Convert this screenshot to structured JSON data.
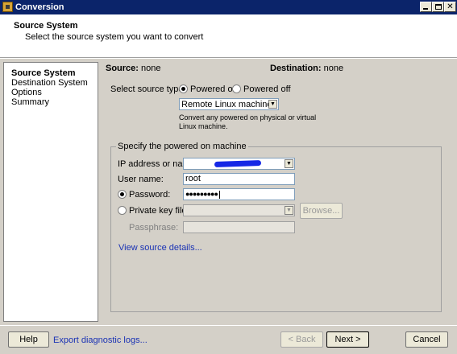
{
  "window": {
    "title": "Conversion"
  },
  "header": {
    "title": "Source System",
    "subtitle": "Select the source system you want to convert"
  },
  "nav": {
    "items": [
      {
        "label": "Source System",
        "active": true
      },
      {
        "label": "Destination System",
        "active": false
      },
      {
        "label": "Options",
        "active": false
      },
      {
        "label": "Summary",
        "active": false
      }
    ]
  },
  "summary": {
    "source_label": "Source:",
    "source_value": "none",
    "destination_label": "Destination:",
    "destination_value": "none"
  },
  "source_type": {
    "label": "Select source type:",
    "powered_on": "Powered on",
    "powered_off": "Powered off",
    "selected": "Powered on",
    "machine_type": "Remote Linux machine",
    "description_line1": "Convert any powered on physical or virtual",
    "description_line2": "Linux machine."
  },
  "machine": {
    "group_title": "Specify the powered on machine",
    "ip_label": "IP address or name:",
    "ip_value": "",
    "user_label": "User name:",
    "user_value": "root",
    "password_label": "Password:",
    "password_value": "●●●●●●●●●",
    "private_key_label": "Private key file:",
    "private_key_value": "",
    "browse": "Browse...",
    "passphrase_label": "Passphrase:",
    "passphrase_value": "",
    "details_link": "View source details...",
    "auth_selected": "Password"
  },
  "footer": {
    "help": "Help",
    "export_link": "Export diagnostic logs...",
    "back": "< Back",
    "next": "Next >",
    "cancel": "Cancel"
  }
}
